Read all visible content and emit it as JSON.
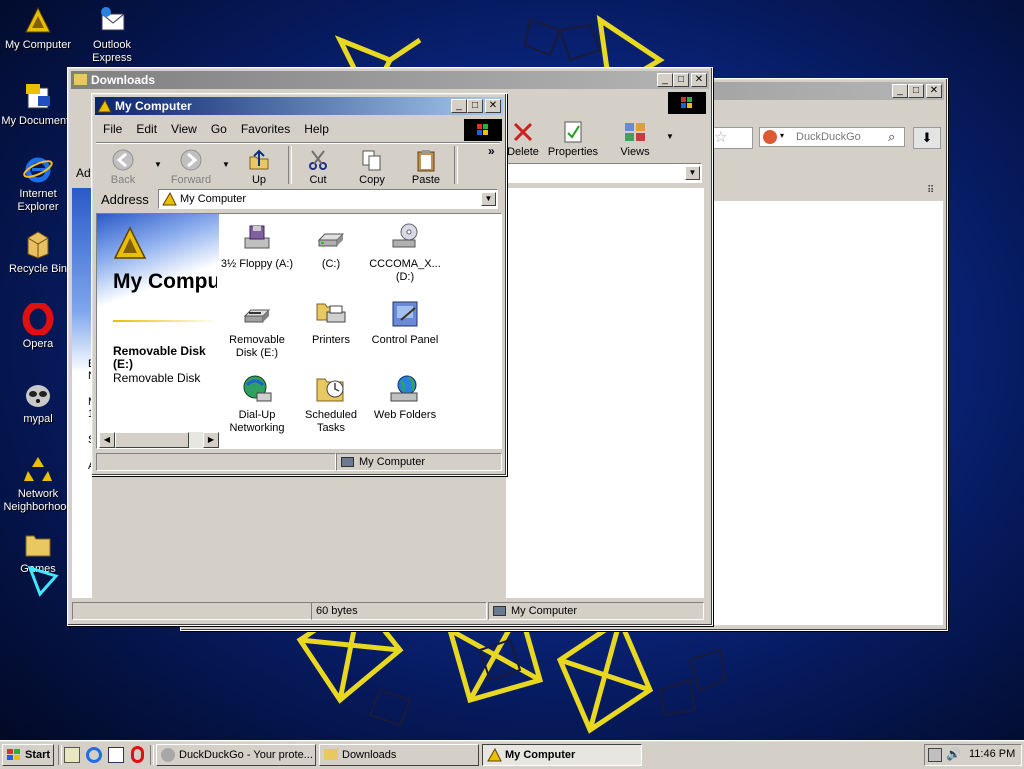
{
  "desktop": {
    "icons": [
      {
        "label": "My Computer",
        "icon": "my-computer-icon"
      },
      {
        "label": "My Documents",
        "icon": "my-documents-icon"
      },
      {
        "label": "Internet Explorer",
        "icon": "internet-explorer-icon"
      },
      {
        "label": "Recycle Bin",
        "icon": "recycle-bin-icon"
      },
      {
        "label": "Opera",
        "icon": "opera-icon"
      },
      {
        "label": "mypal",
        "icon": "mypal-icon"
      },
      {
        "label": "Network Neighborhood",
        "icon": "network-neighborhood-icon"
      },
      {
        "label": "Games",
        "icon": "folder-icon"
      },
      {
        "label": "Outlook Express",
        "icon": "outlook-express-icon"
      }
    ]
  },
  "browser": {
    "search_engine": "DuckDuckGo"
  },
  "downloads": {
    "title": "Downloads",
    "toolbar": {
      "delete": "Delete",
      "properties": "Properties",
      "views": "Views"
    },
    "address_label": "Ad",
    "status_size": "60 bytes",
    "status_zone": "My Computer",
    "side_fragments": [
      "E",
      "N",
      "M",
      "1",
      "S",
      "A"
    ]
  },
  "mycomputer": {
    "title": "My Computer",
    "menu": [
      "File",
      "Edit",
      "View",
      "Go",
      "Favorites",
      "Help"
    ],
    "toolbar": {
      "back": "Back",
      "forward": "Forward",
      "up": "Up",
      "cut": "Cut",
      "copy": "Copy",
      "paste": "Paste"
    },
    "address_label": "Address",
    "address_value": "My Computer",
    "side_title": "My Compute",
    "side_name": "Removable Disk (E:)",
    "side_desc": "Removable Disk",
    "items": [
      {
        "label": "3½ Floppy (A:)",
        "icon": "floppy-drive-icon"
      },
      {
        "label": "(C:)",
        "icon": "hard-drive-icon"
      },
      {
        "label": "CCCOMA_X... (D:)",
        "icon": "cd-drive-icon"
      },
      {
        "label": "Removable Disk (E:)",
        "icon": "removable-disk-icon"
      },
      {
        "label": "Printers",
        "icon": "printers-icon"
      },
      {
        "label": "Control Panel",
        "icon": "control-panel-icon"
      },
      {
        "label": "Dial-Up Networking",
        "icon": "dial-up-networking-icon"
      },
      {
        "label": "Scheduled Tasks",
        "icon": "scheduled-tasks-icon"
      },
      {
        "label": "Web Folders",
        "icon": "web-folders-icon"
      }
    ],
    "status": "My Computer"
  },
  "taskbar": {
    "start": "Start",
    "tasks": [
      {
        "label": "DuckDuckGo - Your prote..."
      },
      {
        "label": "Downloads"
      },
      {
        "label": "My Computer"
      }
    ],
    "clock": "11:46 PM"
  },
  "colors": {
    "active_title": "#0a246a",
    "inactive_title": "#808080",
    "face": "#d4d0c8",
    "desktop": "#0b2a8a"
  }
}
